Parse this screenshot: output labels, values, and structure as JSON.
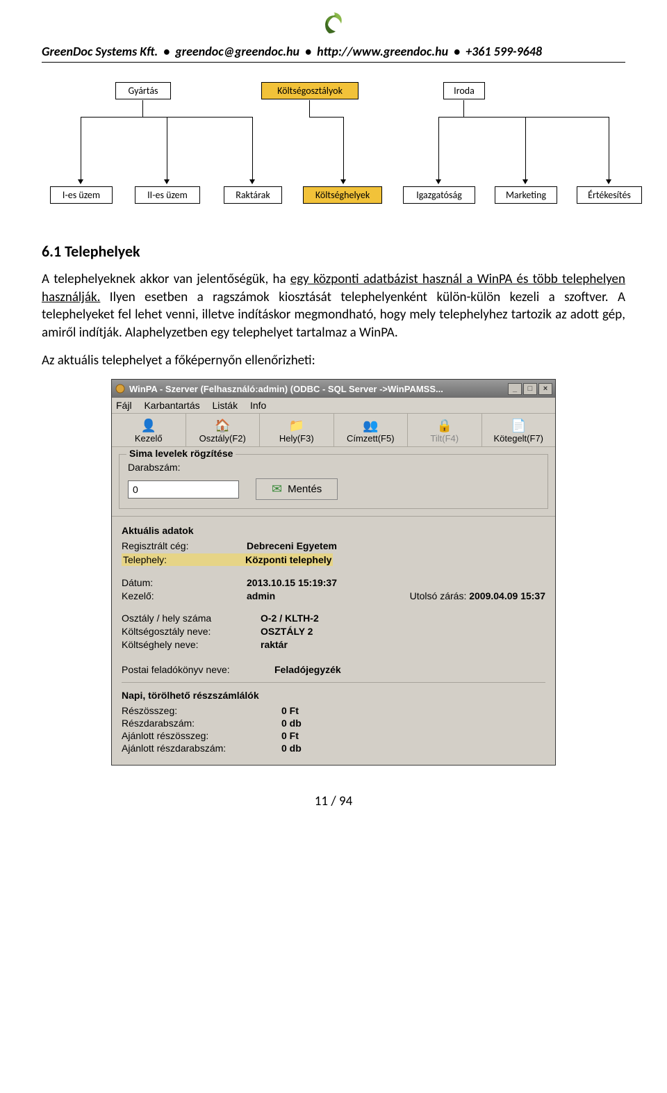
{
  "header": {
    "company": "GreenDoc Systems Kft.",
    "email": "greendoc@greendoc.hu",
    "url": "http://www.greendoc.hu",
    "phone": "+361 599-9648",
    "sep": "•"
  },
  "orgchart": {
    "top": {
      "gyartas": "Gyártás",
      "koltseg": "Költségosztályok",
      "iroda": "Iroda"
    },
    "bottom": {
      "ies": "I-es üzem",
      "iies": "II-es üzem",
      "raktarak": "Raktárak",
      "koltseghely": "Költséghelyek",
      "igaz": "Igazgatóság",
      "marketing": "Marketing",
      "ertek": "Értékesítés"
    }
  },
  "section": {
    "title": "6.1 Telephelyek",
    "p1a": "A telephelyeknek akkor van jelentőségük, ha ",
    "p1u": "egy központi adatbázist használ a WinPA és több telephelyen használják.",
    "p1b": " Ilyen esetben a ragszámok kiosztását telephelyenként külön-külön kezeli a szoftver. A telephelyeket fel lehet venni, illetve indításkor megmondható, hogy mely telephelyhez tartozik az adott gép, amiről indítják. Alaphelyzetben egy telephelyet tartalmaz a WinPA.",
    "p2": "Az aktuális telephelyet a főképernyőn ellenőrizheti:"
  },
  "win": {
    "title": "WinPA - Szerver (Felhasználó:admin)  (ODBC - SQL Server ->WinPAMSS...",
    "menu": {
      "fajl": "Fájl",
      "karb": "Karbantartás",
      "listak": "Listák",
      "info": "Info"
    },
    "toolbar": {
      "kezelo": "Kezelő",
      "osztaly": "Osztály(F2)",
      "hely": "Hely(F3)",
      "cimzett": "Címzett(F5)",
      "tilt": "Tilt(F4)",
      "koteg": "Kötegelt(F7)"
    },
    "sima": {
      "legend": "Sima levelek rögzítése",
      "darab": "Darabszám:",
      "value": "0",
      "mentes": "Mentés"
    },
    "aktual": {
      "title": "Aktuális adatok",
      "regceg_k": "Regisztrált cég:",
      "regceg_v": "Debreceni Egyetem",
      "telephely_k": "Telephely:",
      "telephely_v": "Központi telephely",
      "datum_k": "Dátum:",
      "datum_v": "2013.10.15    15:19:37",
      "kezelo_k": "Kezelő:",
      "kezelo_v": "admin",
      "utolso_k": "Utolsó zárás:",
      "utolso_v": "2009.04.09 15:37",
      "osz_k": "Osztály / hely száma",
      "osz_v": "O-2 / KLTH-2",
      "kon_k": "Költségosztály neve:",
      "kon_v": "OSZTÁLY 2",
      "khn_k": "Költséghely neve:",
      "khn_v": "raktár",
      "pfn_k": "Postai feladókönyv neve:",
      "pfn_v": "Feladójegyzék"
    },
    "napi": {
      "title": "Napi, törölhető részszámlálók",
      "r1k": "Részösszeg:",
      "r1v": "0 Ft",
      "r2k": "Részdarabszám:",
      "r2v": "0 db",
      "r3k": "Ajánlott részösszeg:",
      "r3v": "0 Ft",
      "r4k": "Ajánlott részdarabszám:",
      "r4v": "0 db"
    }
  },
  "footer": {
    "page": "11 / 94"
  }
}
